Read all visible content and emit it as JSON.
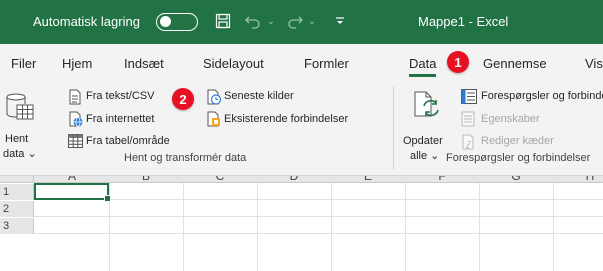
{
  "titlebar": {
    "autosave_label": "Automatisk lagring",
    "toggle_state": "off",
    "save_icon": "save-icon",
    "undo_icon": "undo-icon",
    "redo_icon": "redo-icon",
    "customize_icon": "customize-quick-access-icon",
    "title": "Mappe1  -  Excel",
    "bg_color": "#217346"
  },
  "tabs": [
    {
      "label": "Filer"
    },
    {
      "label": "Hjem"
    },
    {
      "label": "Indsæt"
    },
    {
      "label": "Sidelayout"
    },
    {
      "label": "Formler"
    },
    {
      "label": "Data",
      "active": true
    },
    {
      "label": "Gennemse"
    },
    {
      "label": "Vis"
    }
  ],
  "badges": [
    {
      "number": "1",
      "color": "#e81123"
    },
    {
      "number": "2",
      "color": "#e81123"
    }
  ],
  "ribbon": {
    "get_data": {
      "label_line1": "Hent",
      "label_line2": "data ⌄",
      "icon": "database-table-icon"
    },
    "from_text_csv": {
      "label": "Fra tekst/CSV",
      "icon": "text-file-icon"
    },
    "from_web": {
      "label": "Fra internettet",
      "icon": "web-icon"
    },
    "from_table": {
      "label": "Fra tabel/område",
      "icon": "table-icon"
    },
    "recent_sources": {
      "label": "Seneste kilder",
      "icon": "recent-sources-icon"
    },
    "existing_connections": {
      "label": "Eksisterende forbindelser",
      "icon": "connections-icon"
    },
    "group1_label": "Hent og transformér data",
    "refresh_all": {
      "label_line1": "Opdater",
      "label_line2": "alle ⌄",
      "icon": "refresh-icon"
    },
    "queries_connections": {
      "label": "Forespørgsler og forbindelser",
      "icon": "queries-icon"
    },
    "properties": {
      "label": "Egenskaber",
      "icon": "properties-icon",
      "enabled": false
    },
    "edit_links": {
      "label": "Rediger kæder",
      "icon": "edit-links-icon",
      "enabled": false
    },
    "group2_label": "Forespørgsler og forbindelser"
  },
  "grid": {
    "columns": [
      "A",
      "B",
      "C",
      "D",
      "E",
      "F",
      "G",
      "H"
    ],
    "rows": [
      "1",
      "2",
      "3"
    ],
    "active_cell": "A1",
    "accent": "#217346"
  }
}
